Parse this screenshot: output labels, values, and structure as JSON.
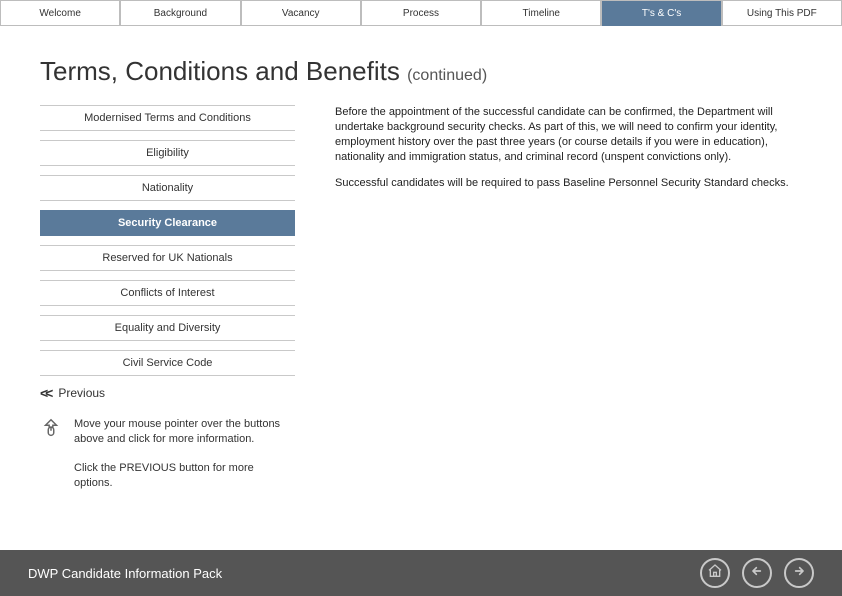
{
  "tabs": [
    {
      "label": "Welcome"
    },
    {
      "label": "Background"
    },
    {
      "label": "Vacancy"
    },
    {
      "label": "Process"
    },
    {
      "label": "Timeline"
    },
    {
      "label": "T's & C's"
    },
    {
      "label": "Using This PDF"
    }
  ],
  "active_tab_index": 5,
  "heading": {
    "main": "Terms, Conditions and Benefits",
    "suffix": "(continued)"
  },
  "sidebar": {
    "items": [
      {
        "label": "Modernised Terms and Conditions"
      },
      {
        "label": "Eligibility"
      },
      {
        "label": "Nationality"
      },
      {
        "label": "Security Clearance"
      },
      {
        "label": "Reserved for UK Nationals"
      },
      {
        "label": "Conflicts of Interest"
      },
      {
        "label": "Equality and Diversity"
      },
      {
        "label": "Civil Service Code"
      }
    ],
    "active_index": 3
  },
  "previous": {
    "label": "Previous"
  },
  "hints": [
    {
      "icon": "mouse-pointer-icon",
      "text": "Move your mouse pointer over the buttons above and click for more information."
    },
    {
      "icon": null,
      "text": "Click the PREVIOUS button for more options."
    }
  ],
  "body": {
    "p1": "Before the appointment of the successful candidate can be confirmed, the Department will undertake background security checks. As part of this, we will need to confirm your identity, employment history over the past three years (or course details if you were in education), nationality and immigration status, and criminal record (unspent convictions only).",
    "p2": "Successful candidates will be required to pass Baseline Personnel Security Standard checks."
  },
  "footer": {
    "title": "DWP Candidate Information Pack"
  }
}
